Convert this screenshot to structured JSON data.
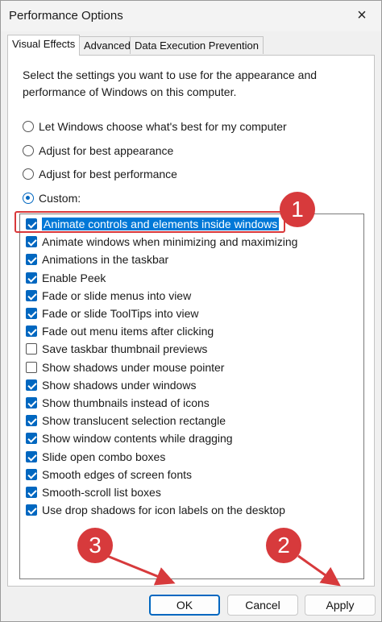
{
  "window": {
    "title": "Performance Options",
    "close_icon": "×"
  },
  "tabs": [
    {
      "label": "Visual Effects",
      "active": true
    },
    {
      "label": "Advanced",
      "active": false
    },
    {
      "label": "Data Execution Prevention",
      "active": false
    }
  ],
  "description": "Select the settings you want to use for the appearance and performance of Windows on this computer.",
  "radios": [
    {
      "label": "Let Windows choose what's best for my computer",
      "checked": false
    },
    {
      "label": "Adjust for best appearance",
      "checked": false
    },
    {
      "label": "Adjust for best performance",
      "checked": false
    },
    {
      "label": "Custom:",
      "checked": true
    }
  ],
  "options": [
    {
      "label": "Animate controls and elements inside windows",
      "checked": true,
      "selected": true
    },
    {
      "label": "Animate windows when minimizing and maximizing",
      "checked": true
    },
    {
      "label": "Animations in the taskbar",
      "checked": true
    },
    {
      "label": "Enable Peek",
      "checked": true
    },
    {
      "label": "Fade or slide menus into view",
      "checked": true
    },
    {
      "label": "Fade or slide ToolTips into view",
      "checked": true
    },
    {
      "label": "Fade out menu items after clicking",
      "checked": true
    },
    {
      "label": "Save taskbar thumbnail previews",
      "checked": false
    },
    {
      "label": "Show shadows under mouse pointer",
      "checked": false
    },
    {
      "label": "Show shadows under windows",
      "checked": true
    },
    {
      "label": "Show thumbnails instead of icons",
      "checked": true
    },
    {
      "label": "Show translucent selection rectangle",
      "checked": true
    },
    {
      "label": "Show window contents while dragging",
      "checked": true
    },
    {
      "label": "Slide open combo boxes",
      "checked": true
    },
    {
      "label": "Smooth edges of screen fonts",
      "checked": true
    },
    {
      "label": "Smooth-scroll list boxes",
      "checked": true
    },
    {
      "label": "Use drop shadows for icon labels on the desktop",
      "checked": true
    }
  ],
  "buttons": {
    "ok": "OK",
    "cancel": "Cancel",
    "apply": "Apply"
  },
  "annotations": {
    "badge1": "1",
    "badge2": "2",
    "badge3": "3"
  },
  "colors": {
    "accent": "#0067c0",
    "annotation": "#d73a3c"
  }
}
